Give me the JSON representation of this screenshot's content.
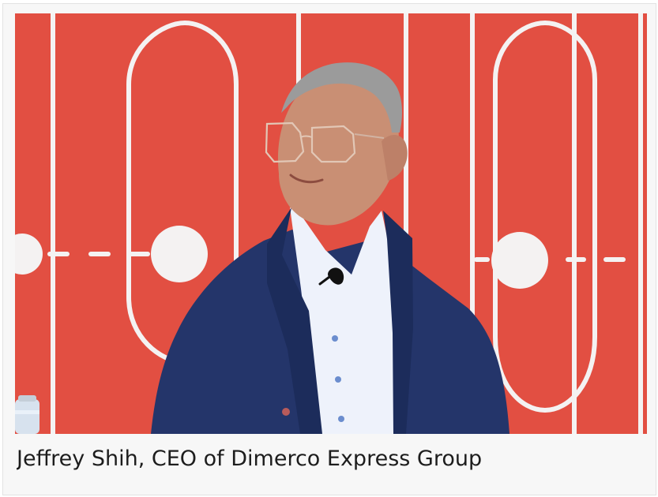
{
  "figure": {
    "caption": "Jeffrey Shih, CEO of Dimerco Express Group",
    "colors": {
      "backdrop_red": "#e24f42",
      "backdrop_line": "#f4f2f2",
      "jacket_navy": "#24356a",
      "shirt_white": "#eef2fb",
      "hair_gray": "#9b9b9b",
      "skin": "#c98f74"
    }
  }
}
